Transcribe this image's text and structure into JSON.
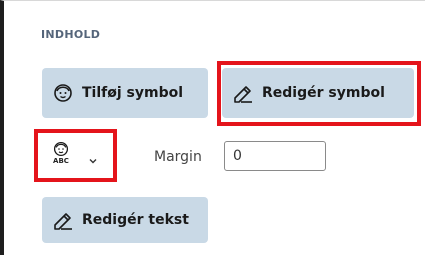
{
  "section": {
    "title": "INDHOLD"
  },
  "buttons": {
    "add_symbol": {
      "label": "Tilføj symbol",
      "icon": "face-icon"
    },
    "edit_symbol": {
      "label": "Redigér symbol",
      "icon": "pencil-icon"
    },
    "edit_text": {
      "label": "Redigér tekst",
      "icon": "pencil-icon"
    }
  },
  "symbol_dropdown": {
    "icon": "face-abc-icon",
    "caption": "ABC"
  },
  "margin": {
    "label": "Margin",
    "value": "0"
  },
  "colors": {
    "button_bg": "#c9d9e6",
    "highlight": "#e4141b"
  }
}
